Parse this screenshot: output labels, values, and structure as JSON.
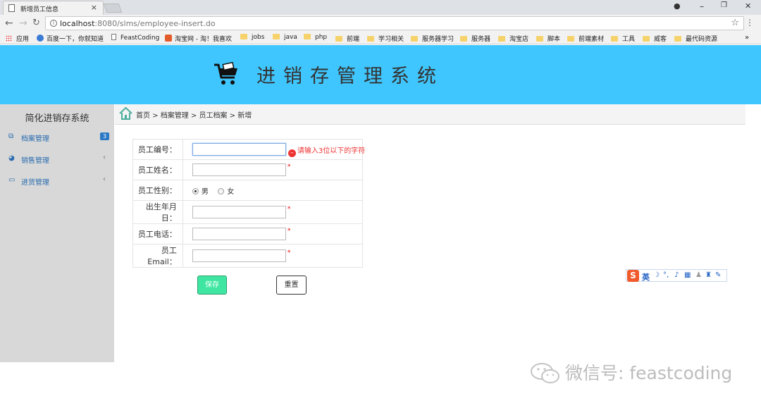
{
  "browser": {
    "tab_title": "新增员工信息",
    "tab_close": "×",
    "url_host": "localhost",
    "url_path": ":8080/slms/employee-insert.do",
    "window_controls": {
      "minimize": "–",
      "restore": "❐",
      "close": "✕"
    },
    "bookmarks": [
      {
        "label": "应用",
        "icon": "apps-grid-icon"
      },
      {
        "label": "百度一下，你就知道",
        "icon": "baidu-icon"
      },
      {
        "label": "FeastCoding",
        "icon": "page-icon"
      },
      {
        "label": "淘宝网 - 淘！我喜欢",
        "icon": "taobao-icon"
      },
      {
        "label": "jobs",
        "icon": "folder-icon"
      },
      {
        "label": "java",
        "icon": "folder-icon"
      },
      {
        "label": "php",
        "icon": "folder-icon"
      },
      {
        "label": "前端",
        "icon": "folder-icon"
      },
      {
        "label": "学习相关",
        "icon": "folder-icon"
      },
      {
        "label": "服务器学习",
        "icon": "folder-icon"
      },
      {
        "label": "服务器",
        "icon": "folder-icon"
      },
      {
        "label": "淘宝店",
        "icon": "folder-icon"
      },
      {
        "label": "脚本",
        "icon": "folder-icon"
      },
      {
        "label": "前端素材",
        "icon": "folder-icon"
      },
      {
        "label": "工具",
        "icon": "folder-icon"
      },
      {
        "label": "威客",
        "icon": "folder-icon"
      },
      {
        "label": "最代码资源",
        "icon": "folder-icon"
      }
    ],
    "bookmarks_overflow": "»"
  },
  "header": {
    "title": "进销存管理系统",
    "icon": "shopping-cart-icon",
    "background": "#3fc6fe"
  },
  "sidebar": {
    "title": "简化进销存系统",
    "items": [
      {
        "label": "档案管理",
        "icon": "copy-icon",
        "badge": "3"
      },
      {
        "label": "销售管理",
        "icon": "pie-chart-icon",
        "chevron": "‹"
      },
      {
        "label": "进货管理",
        "icon": "laptop-icon",
        "chevron": "‹"
      }
    ]
  },
  "breadcrumb": {
    "icon": "home-icon",
    "text": "首页 > 档案管理 > 员工档案 > 新增"
  },
  "form": {
    "fields": [
      {
        "label": "员工编号：",
        "value": "",
        "required": false,
        "error": "请输入3位以下的字符"
      },
      {
        "label": "员工姓名：",
        "value": "",
        "required": true
      },
      {
        "label": "员工性别：",
        "options": [
          "男",
          "女"
        ],
        "selected": "男"
      },
      {
        "label": "出生年月日：",
        "value": "",
        "required": true
      },
      {
        "label": "员工电话：",
        "value": "",
        "required": true
      },
      {
        "label": "员工Email：",
        "value": "",
        "required": true
      }
    ],
    "required_mark": "*",
    "error_icon_glyph": "–",
    "save_label": "保存",
    "reset_label": "重置"
  },
  "ime": {
    "logo": "S",
    "lang": "英"
  },
  "watermark": "微信号: feastcoding",
  "colors": {
    "accent_blue": "#3fc6fe",
    "save_green": "#3fe6a1",
    "error_red": "#e33333",
    "sidebar_bg": "#d8d8d8",
    "link_blue": "#2a6cb0"
  }
}
